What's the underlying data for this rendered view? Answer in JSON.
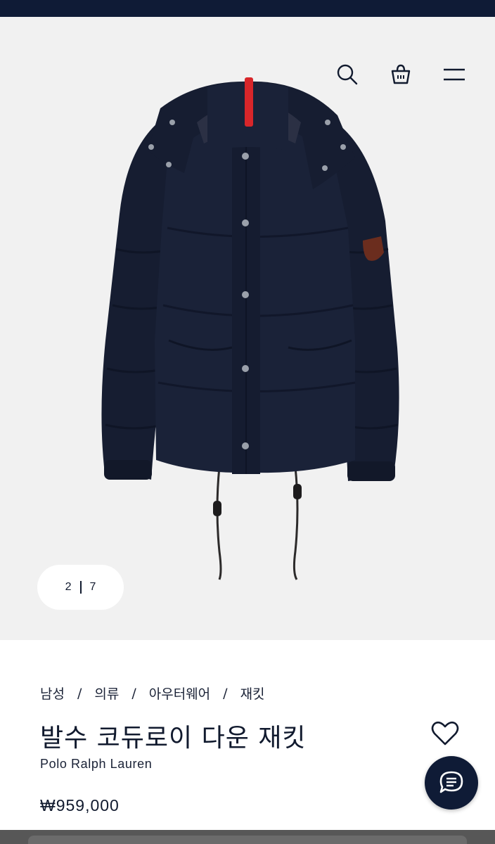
{
  "header": {
    "icons": [
      "search-icon",
      "shopping-bag-icon",
      "menu-icon"
    ]
  },
  "gallery": {
    "current": "2",
    "total": "7"
  },
  "product": {
    "breadcrumb": [
      "남성",
      "의류",
      "아우터웨어",
      "재킷"
    ],
    "breadcrumb_separator": "/",
    "title": "발수 코듀로이 다운 재킷",
    "brand": "Polo Ralph Lauren",
    "price": "₩959,000"
  },
  "actions": {
    "wishlist_icon": "heart-icon",
    "chat_icon": "chat-icon"
  },
  "colors": {
    "navy": "#0f1b36",
    "jacket": "#1a2238",
    "accent_red": "#d8262a",
    "gallery_bg": "#f1f1f1"
  }
}
